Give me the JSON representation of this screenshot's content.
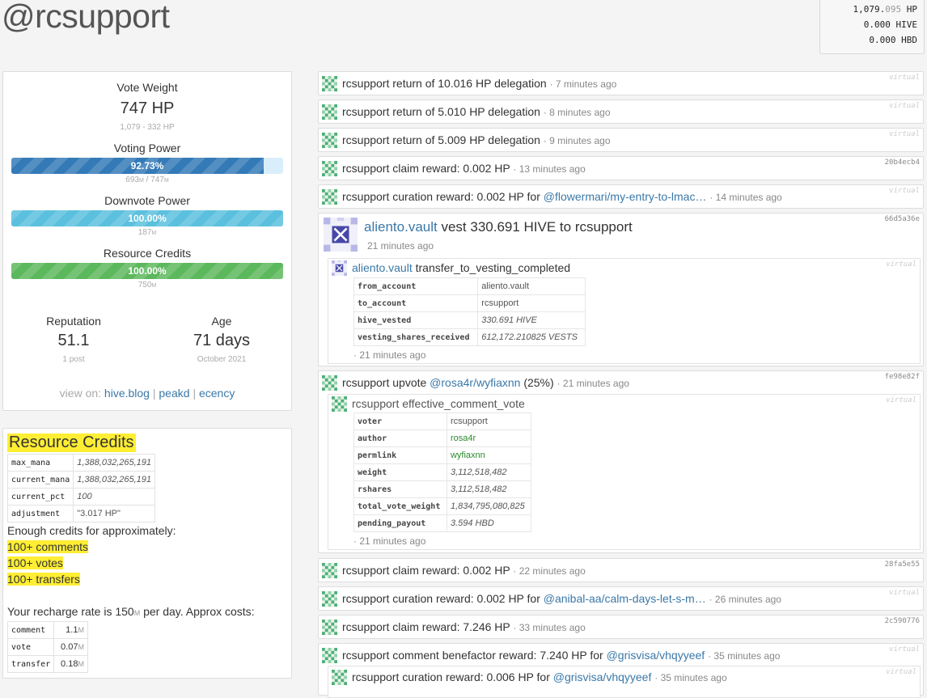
{
  "account": {
    "title": "@rcsupport"
  },
  "balances": {
    "hp_main": "1,079.",
    "hp_dim": "095",
    "hp_unit": " HP",
    "hive": "0.000 HIVE",
    "hbd": "0.000 HBD"
  },
  "vote_weight": {
    "label": "Vote Weight",
    "value": "747 HP",
    "sub": "1,079 - 332 HP"
  },
  "voting_power": {
    "label": "Voting Power",
    "percent": 92.73,
    "text": "92.73%",
    "sub_a": "693",
    "sub_b": "M",
    "sub_c": " / 747",
    "sub_d": "M"
  },
  "downvote_power": {
    "label": "Downvote Power",
    "percent": 100,
    "text": "100.00%",
    "sub_a": "187",
    "sub_b": "M"
  },
  "resource_credits_bar": {
    "label": "Resource Credits",
    "percent": 100,
    "text": "100.00%",
    "sub_a": "750",
    "sub_b": "M"
  },
  "reputation": {
    "label": "Reputation",
    "value": "51.1",
    "sub": "1 post"
  },
  "age": {
    "label": "Age",
    "value": "71 days",
    "sub": "October 2021"
  },
  "view_on": {
    "prefix": "view on:",
    "links": [
      "hive.blog",
      "peakd",
      "ecency"
    ],
    "sep": "|"
  },
  "rc": {
    "title": "Resource Credits",
    "table": [
      {
        "k": "max_mana",
        "v": "1,388,032,265,191"
      },
      {
        "k": "current_mana",
        "v": "1,388,032,265,191"
      },
      {
        "k": "current_pct",
        "v": "100"
      },
      {
        "k": "adjustment",
        "v": "\"3.017 HP\""
      }
    ],
    "enough": "Enough credits for approximately:",
    "comments": "100+ comments",
    "votes": "100+ votes",
    "transfers": "100+ transfers",
    "recharge_a": "Your recharge rate is 150",
    "recharge_u": "M",
    "recharge_b": " per day. Approx costs:",
    "costs": [
      {
        "k": "comment",
        "v": "1.1",
        "u": "M"
      },
      {
        "k": "vote",
        "v": "0.07",
        "u": "M"
      },
      {
        "k": "transfer",
        "v": "0.18",
        "u": "M"
      }
    ]
  },
  "ops": [
    {
      "text": "rcsupport return of 10.016 HP delegation",
      "ago": "· 7 minutes ago",
      "tag": "virtual"
    },
    {
      "text": "rcsupport return of 5.010 HP delegation",
      "ago": "· 8 minutes ago",
      "tag": "virtual"
    },
    {
      "text": "rcsupport return of 5.009 HP delegation",
      "ago": "· 9 minutes ago",
      "tag": "virtual"
    },
    {
      "text": "rcsupport claim reward: 0.002 HP",
      "ago": "· 13 minutes ago",
      "tag": "20b4ecb4"
    },
    {
      "text": "rcsupport curation reward: 0.002 HP for ",
      "link": "@flowermari/my-entry-to-lmac…",
      "ago": "· 14 minutes ago",
      "tag": "virtual"
    }
  ],
  "vest": {
    "link": "aliento.vault",
    "text": " vest 330.691 HIVE to rcsupport",
    "ago": "21 minutes ago",
    "tag": "66d5a36e",
    "sub_link": "aliento.vault",
    "sub_text": " transfer_to_vesting_completed",
    "sub_tag": "virtual",
    "rows": [
      {
        "k": "from_account",
        "v": "aliento.vault"
      },
      {
        "k": "to_account",
        "v": "rcsupport"
      },
      {
        "k": "hive_vested",
        "v": "330.691 HIVE"
      },
      {
        "k": "vesting_shares_received",
        "v": "612,172.210825 VESTS"
      }
    ],
    "sub_ago": "· 21 minutes ago"
  },
  "upvote": {
    "pre": "rcsupport upvote ",
    "link": "@rosa4r/wyfiaxnn",
    "post": " (25%)",
    "ago": "· 21 minutes ago",
    "tag": "fe98e82f",
    "sub_text": "rcsupport effective_comment_vote",
    "sub_tag": "virtual",
    "rows": [
      {
        "k": "voter",
        "v": "rcsupport"
      },
      {
        "k": "author",
        "v": "rosa4r"
      },
      {
        "k": "permlink",
        "v": "wyfiaxnn"
      },
      {
        "k": "weight",
        "v": "3,112,518,482"
      },
      {
        "k": "rshares",
        "v": "3,112,518,482"
      },
      {
        "k": "total_vote_weight",
        "v": "1,834,795,080,825"
      },
      {
        "k": "pending_payout",
        "v": "3.594 HBD"
      }
    ],
    "sub_ago": "· 21 minutes ago"
  },
  "ops2": [
    {
      "text": "rcsupport claim reward: 0.002 HP",
      "ago": "· 22 minutes ago",
      "tag": "28fa5e55"
    },
    {
      "text": "rcsupport curation reward: 0.002 HP for ",
      "link": "@anibal-aa/calm-days-let-s-m…",
      "ago": "· 26 minutes ago",
      "tag": "virtual"
    },
    {
      "text": "rcsupport claim reward: 7.246 HP",
      "ago": "· 33 minutes ago",
      "tag": "2c590776"
    },
    {
      "text": "rcsupport comment benefactor reward: 7.240 HP for ",
      "link": "@grisvisa/vhqyyeef",
      "ago": "· 35 minutes ago",
      "tag": "virtual"
    }
  ],
  "nested_curation": {
    "text": "rcsupport curation reward: 0.006 HP for ",
    "link": "@grisvisa/vhqyyeef",
    "ago": "· 35 minutes ago",
    "tag": "virtual"
  },
  "colors": {
    "blue": "#337ab7",
    "cyan": "#5bc0de",
    "green": "#5cb85c",
    "highlight": "#ffee33"
  },
  "icons": {
    "avatar": "identicon-icon",
    "vault": "vault-avatar-icon"
  }
}
